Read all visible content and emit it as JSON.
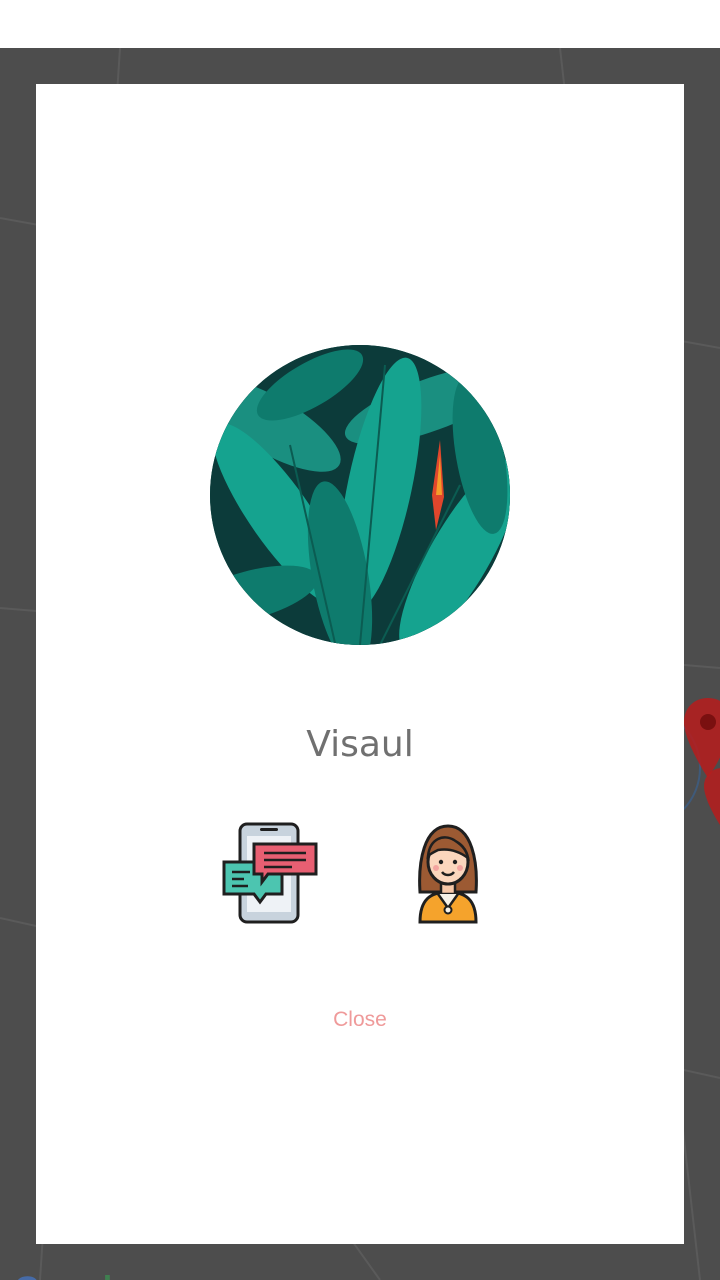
{
  "map": {
    "logo_text": "Google",
    "logo_letters": [
      "G",
      "o",
      "o",
      "g",
      "l",
      "e"
    ],
    "logo_colors": [
      "#4285F4",
      "#EA4335",
      "#FBBC05",
      "#4285F4",
      "#34A853",
      "#EA4335"
    ],
    "marker_color": "#b71c1c",
    "icons": [
      "map-marker-icon"
    ]
  },
  "dialog": {
    "avatar_icon": "profile-photo-leaves",
    "name": "Visaul",
    "actions": [
      {
        "icon": "chat-message-icon"
      },
      {
        "icon": "user-profile-icon"
      }
    ],
    "close_label": "Close"
  },
  "colors": {
    "name_text": "#707070",
    "close_text": "#ef9a9a",
    "overlay": "#4d4d4d"
  }
}
